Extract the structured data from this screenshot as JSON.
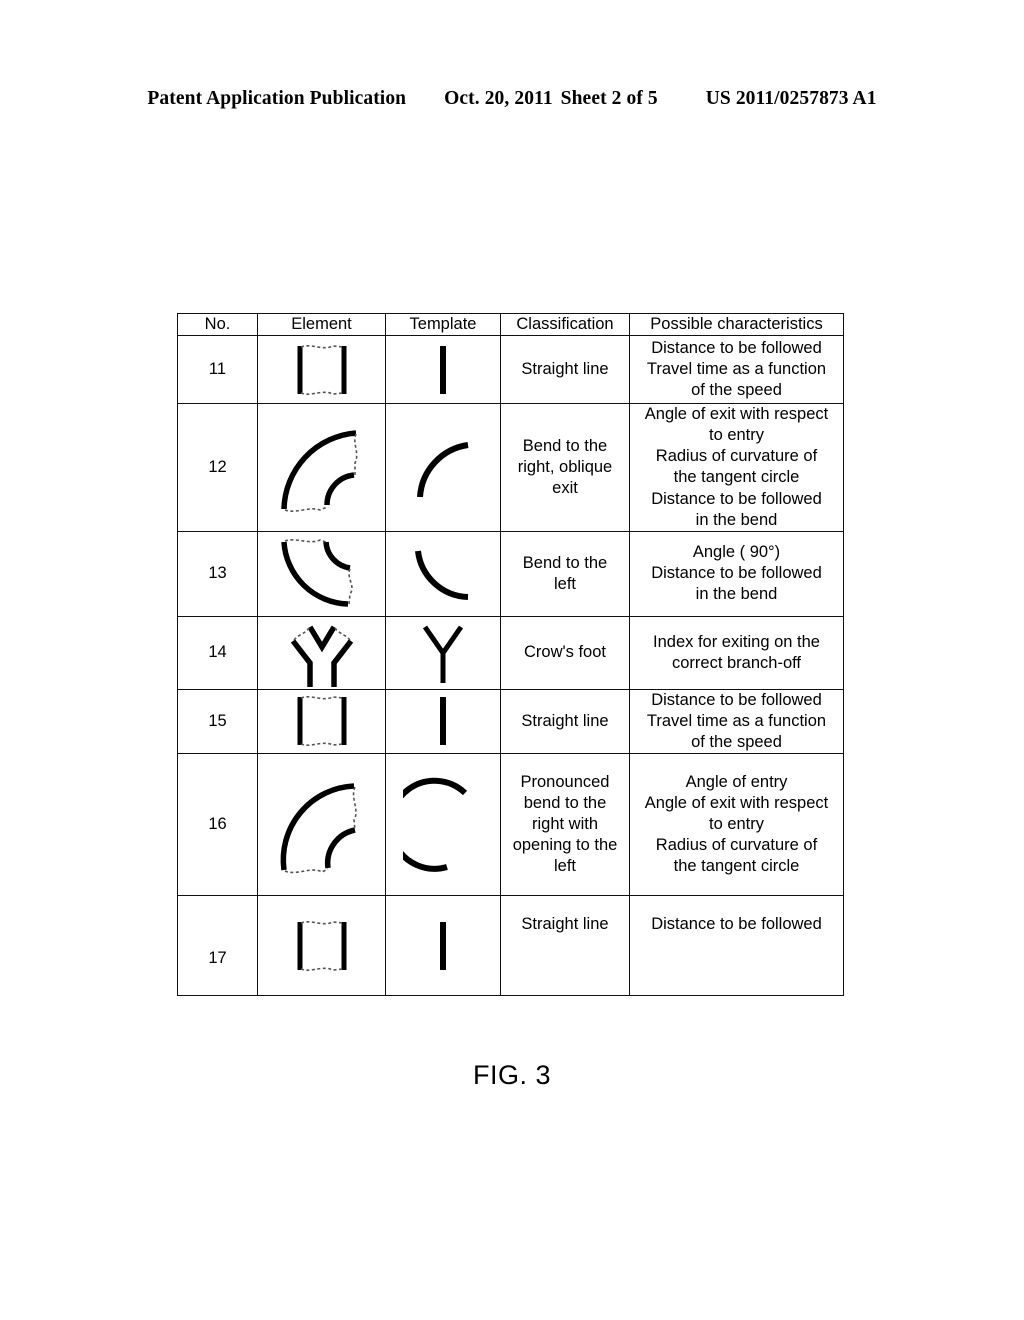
{
  "header": {
    "publication": "Patent Application Publication",
    "date": "Oct. 20, 2011",
    "sheet": "Sheet 2 of 5",
    "patent_number": "US 2011/0257873 A1"
  },
  "table": {
    "columns": [
      "No.",
      "Element",
      "Template",
      "Classification",
      "Possible characteristics"
    ],
    "rows": [
      {
        "no": "11",
        "element_shape": "straight-segment",
        "template_shape": "vertical-bar",
        "classification": "Straight line",
        "characteristics": "Distance to be followed\nTravel time as a function\nof the speed"
      },
      {
        "no": "12",
        "element_shape": "bend-right-oblique",
        "template_shape": "arc-quarter-right",
        "classification": "Bend to the\nright, oblique\nexit",
        "characteristics": "Angle of exit with respect\nto entry\nRadius of curvature of\nthe tangent circle\nDistance to be followed\nin the bend"
      },
      {
        "no": "13",
        "element_shape": "bend-left",
        "template_shape": "arc-quarter-left",
        "classification": "Bend to the\nleft",
        "characteristics": "Angle ( 90°)\nDistance to be followed\nin the bend"
      },
      {
        "no": "14",
        "element_shape": "crows-foot",
        "template_shape": "y-fork",
        "classification": "Crow's foot",
        "characteristics": "Index for exiting on the\ncorrect branch-off"
      },
      {
        "no": "15",
        "element_shape": "straight-segment",
        "template_shape": "vertical-bar",
        "classification": "Straight line",
        "characteristics": "Distance to be followed\nTravel time as a function\nof the speed"
      },
      {
        "no": "16",
        "element_shape": "pronounced-bend-right",
        "template_shape": "arc-large-right",
        "classification": "Pronounced\nbend to the\nright with\nopening to the\nleft",
        "characteristics": "Angle of entry\nAngle of exit with respect\nto entry\nRadius of curvature of\nthe tangent circle"
      },
      {
        "no": "17",
        "element_shape": "straight-segment",
        "template_shape": "vertical-bar",
        "classification": "Straight line",
        "characteristics": "Distance to be followed"
      }
    ]
  },
  "figure": {
    "caption": "FIG. 3"
  }
}
